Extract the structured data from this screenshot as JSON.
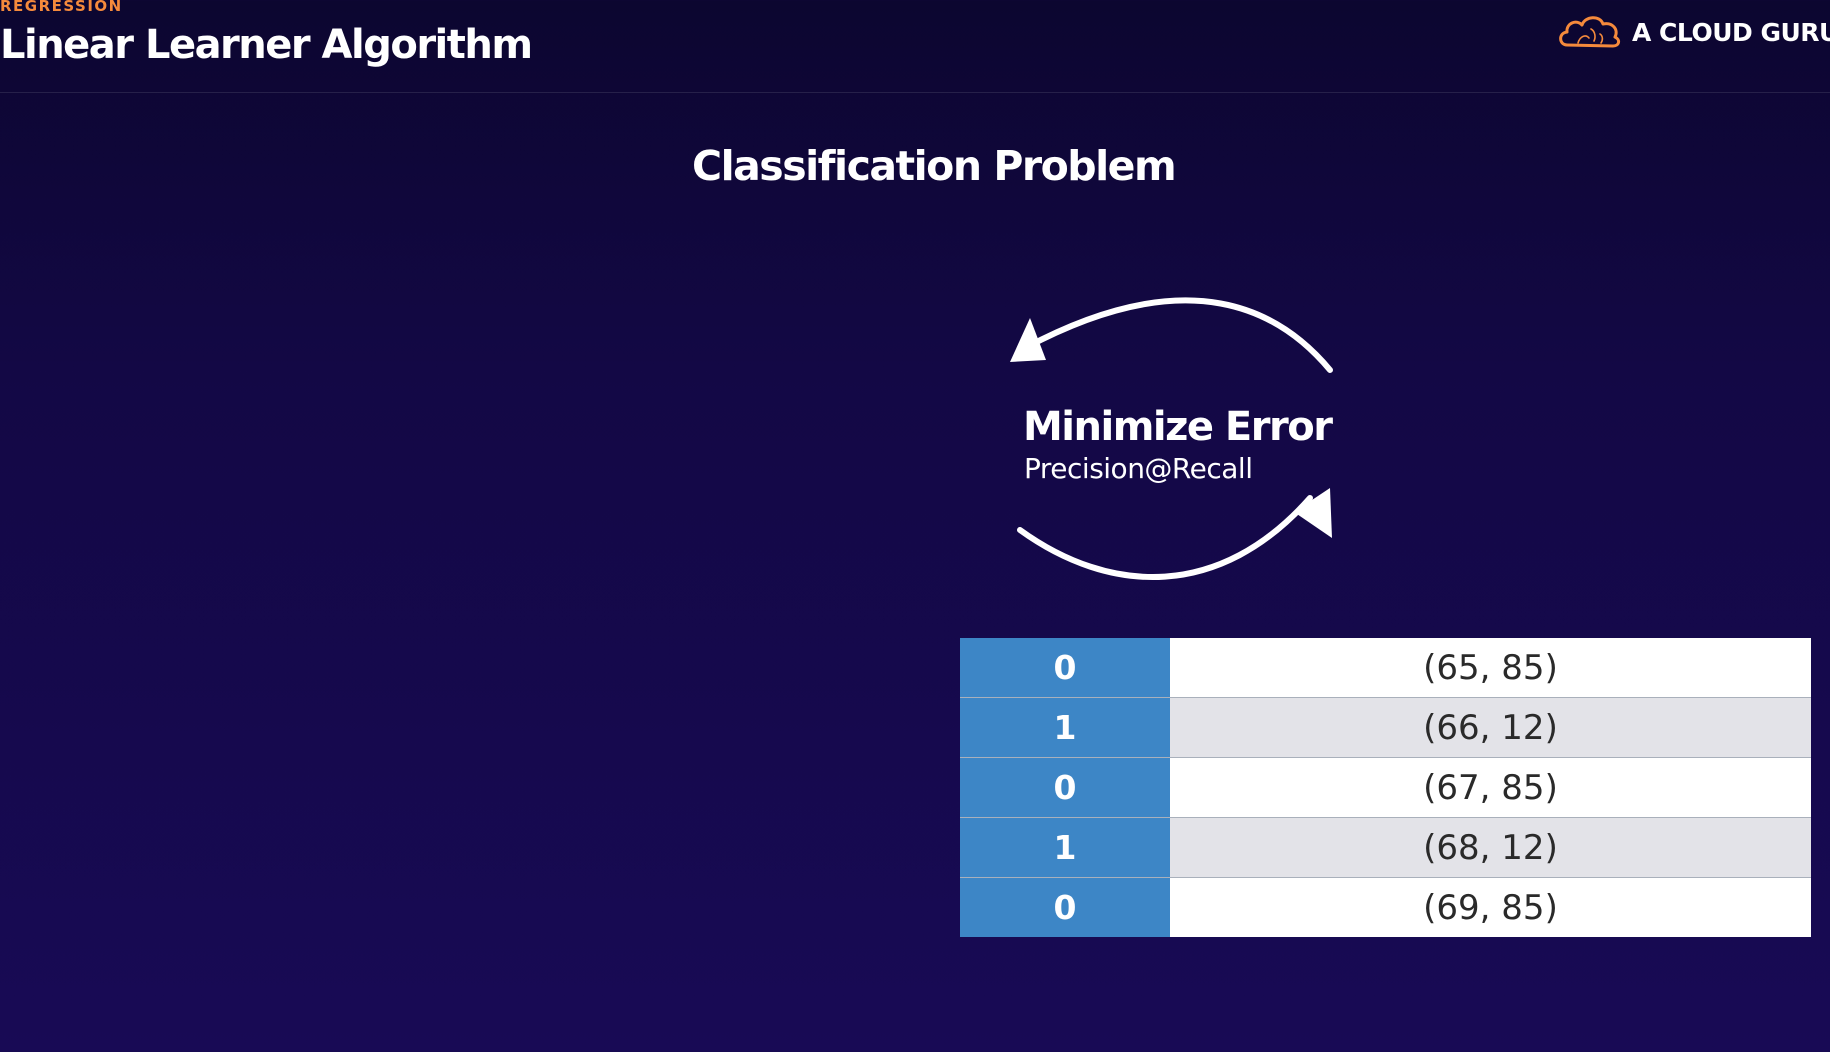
{
  "header": {
    "eyebrow": "REGRESSION",
    "title": "Linear Learner Algorithm",
    "brand": {
      "name": "A CLOUD GURU",
      "icon": "cloud-logo-icon",
      "color": "#f58a3c"
    }
  },
  "slide": {
    "section_title": "Classification Problem",
    "cycle": {
      "heading": "Minimize Error",
      "metric": "Precision@Recall",
      "icon": "cycle-arrows-icon"
    },
    "table": {
      "rows": [
        {
          "label": "0",
          "value": "(65, 85)"
        },
        {
          "label": "1",
          "value": "(66, 12)"
        },
        {
          "label": "0",
          "value": "(67, 85)"
        },
        {
          "label": "1",
          "value": "(68, 12)"
        },
        {
          "label": "0",
          "value": "(69, 85)"
        }
      ]
    }
  },
  "colors": {
    "background": "#130845",
    "accent": "#f58a3c",
    "label_column": "#3d86c6",
    "row_alt": "#e3e3e8"
  }
}
